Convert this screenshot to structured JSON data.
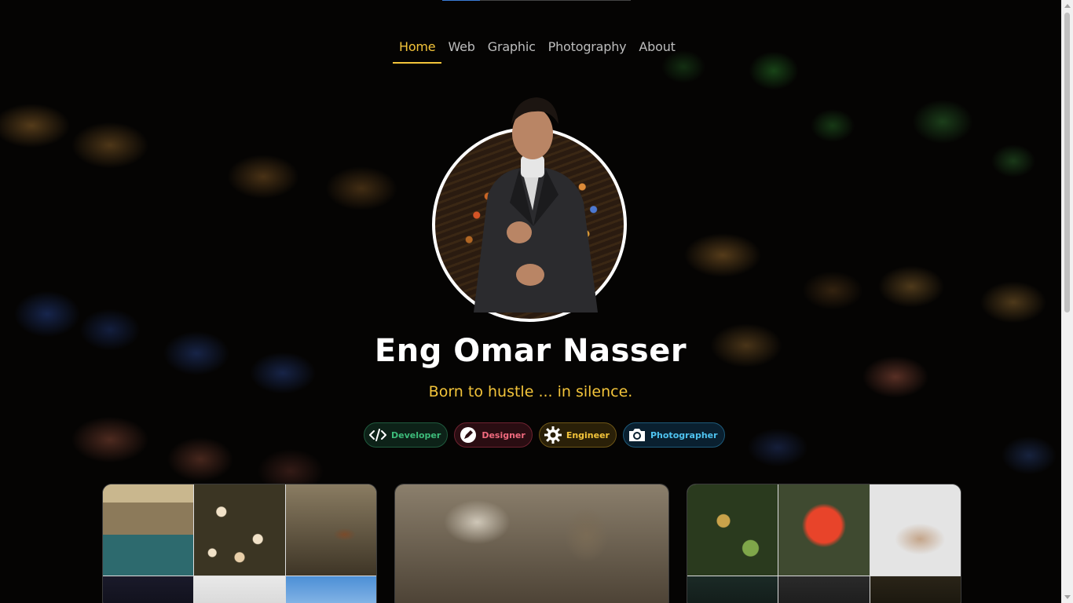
{
  "nav": {
    "items": [
      {
        "label": "Home",
        "active": true
      },
      {
        "label": "Web",
        "active": false
      },
      {
        "label": "Graphic",
        "active": false
      },
      {
        "label": "Photography",
        "active": false
      },
      {
        "label": "About",
        "active": false
      }
    ]
  },
  "profile": {
    "name": "Eng Omar Nasser",
    "tagline": "Born to hustle ... in silence."
  },
  "badges": [
    {
      "label": "Developer",
      "icon": "code-icon",
      "color": "#3dbb7a"
    },
    {
      "label": "Designer",
      "icon": "pen-icon",
      "color": "#f06a7e"
    },
    {
      "label": "Engineer",
      "icon": "gear-icon",
      "color": "#f3c43a"
    },
    {
      "label": "Photographer",
      "icon": "camera-icon",
      "color": "#4fc3f0"
    }
  ],
  "theme": {
    "accent": "#f3c43a",
    "background": "#050403"
  }
}
